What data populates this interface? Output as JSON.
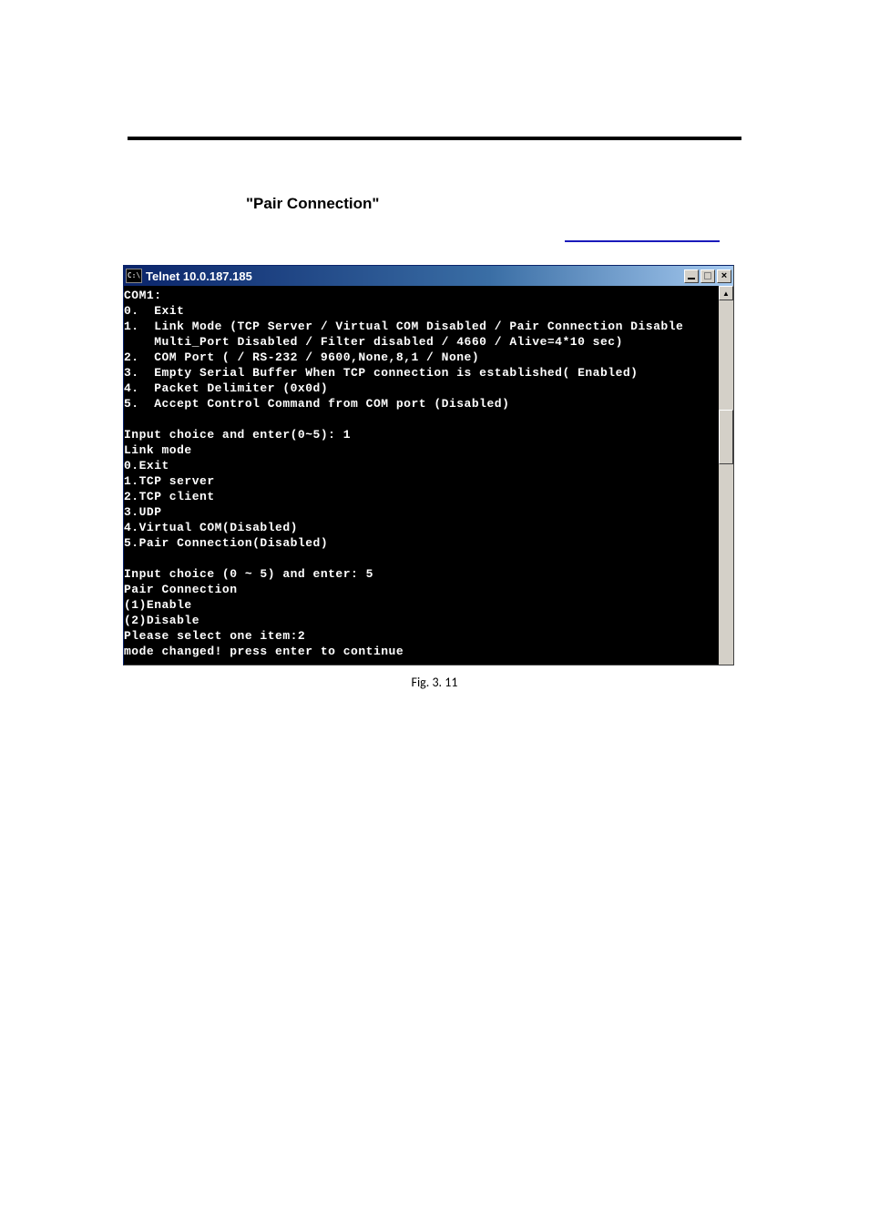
{
  "heading": "\"Pair Connection\"",
  "window": {
    "icon_text": "C:\\",
    "title": "Telnet 10.0.187.185",
    "buttons": {
      "minimize": "_",
      "maximize": "□",
      "close": "×"
    }
  },
  "terminal_lines": [
    "COM1:",
    "0.  Exit",
    "1.  Link Mode (TCP Server / Virtual COM Disabled / Pair Connection Disable",
    "    Multi_Port Disabled / Filter disabled / 4660 / Alive=4*10 sec)",
    "2.  COM Port ( / RS-232 / 9600,None,8,1 / None)",
    "3.  Empty Serial Buffer When TCP connection is established( Enabled)",
    "4.  Packet Delimiter (0x0d)",
    "5.  Accept Control Command from COM port (Disabled)",
    "",
    "Input choice and enter(0~5): 1",
    "Link mode",
    "0.Exit",
    "1.TCP server",
    "2.TCP client",
    "3.UDP",
    "4.Virtual COM(Disabled)",
    "5.Pair Connection(Disabled)",
    "",
    "Input choice (0 ~ 5) and enter: 5",
    "Pair Connection",
    "(1)Enable",
    "(2)Disable",
    "Please select one item:2",
    "mode changed! press enter to continue"
  ],
  "fig_caption": "Fig. 3. 11"
}
